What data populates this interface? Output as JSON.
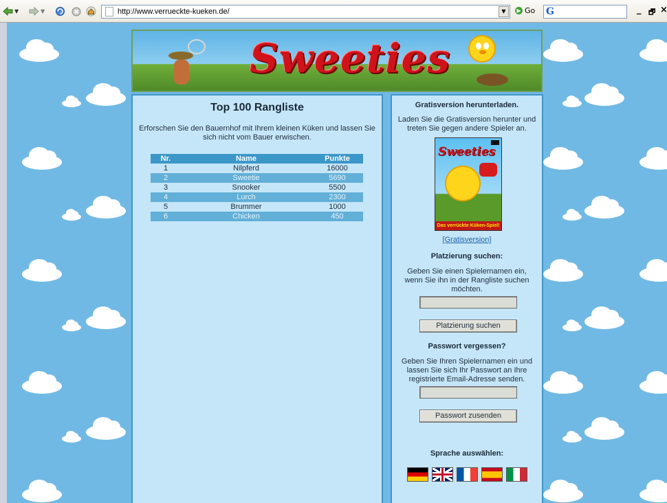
{
  "browser": {
    "url": "http://www.verrueckte-kueken.de/",
    "go_label": "Go",
    "search_logo": "G",
    "minimize_label": "_",
    "restore_label": "🗗",
    "close_label": "×"
  },
  "banner": {
    "logo_text": "Sweeties"
  },
  "main": {
    "title": "Top 100 Rangliste",
    "intro": "Erforschen Sie den Bauernhof mit Ihrem kleinen Küken und lassen Sie sich nicht vom Bauer erwischen.",
    "table": {
      "headers": [
        "Nr.",
        "Name",
        "Punkte"
      ],
      "rows": [
        {
          "nr": "1",
          "name": "Nilpferd",
          "punkte": "16000"
        },
        {
          "nr": "2",
          "name": "Sweetie",
          "punkte": "5690"
        },
        {
          "nr": "3",
          "name": "Snooker",
          "punkte": "5500"
        },
        {
          "nr": "4",
          "name": "Lurch",
          "punkte": "2300"
        },
        {
          "nr": "5",
          "name": "Brummer",
          "punkte": "1000"
        },
        {
          "nr": "6",
          "name": "Chicken",
          "punkte": "450"
        }
      ]
    }
  },
  "side": {
    "download_heading": "Gratisversion herunterladen.",
    "download_text": "Laden Sie die Gratisversion herunter und treten Sie gegen andere Spieler an.",
    "cover_title": "Sweeties",
    "cover_strip": "Das verrückte Küken-Spiel!",
    "download_link": "[Gratisversion]",
    "search_heading": "Platzierung suchen:",
    "search_text": "Geben Sie einen Spielernamen ein, wenn Sie ihn in der Rangliste suchen möchten.",
    "search_input_value": "",
    "search_button": "Platzierung suchen",
    "password_heading": "Passwort vergessen?",
    "password_text": "Geben Sie Ihren Spielernamen ein und lassen Sie sich Ihr Passwort an Ihre registrierte Email-Adresse senden.",
    "password_input_value": "",
    "password_button": "Passwort zusenden",
    "language_heading": "Sprache auswählen:",
    "languages": [
      "de",
      "en",
      "fr",
      "es",
      "it"
    ]
  },
  "colors": {
    "page_bg": "#71b9e5",
    "panel_bg": "#c5e6f8",
    "panel_border": "#3e95c8",
    "table_header": "#3c97c9",
    "table_alt_row": "#62afd7",
    "logo_red": "#d0121a"
  }
}
